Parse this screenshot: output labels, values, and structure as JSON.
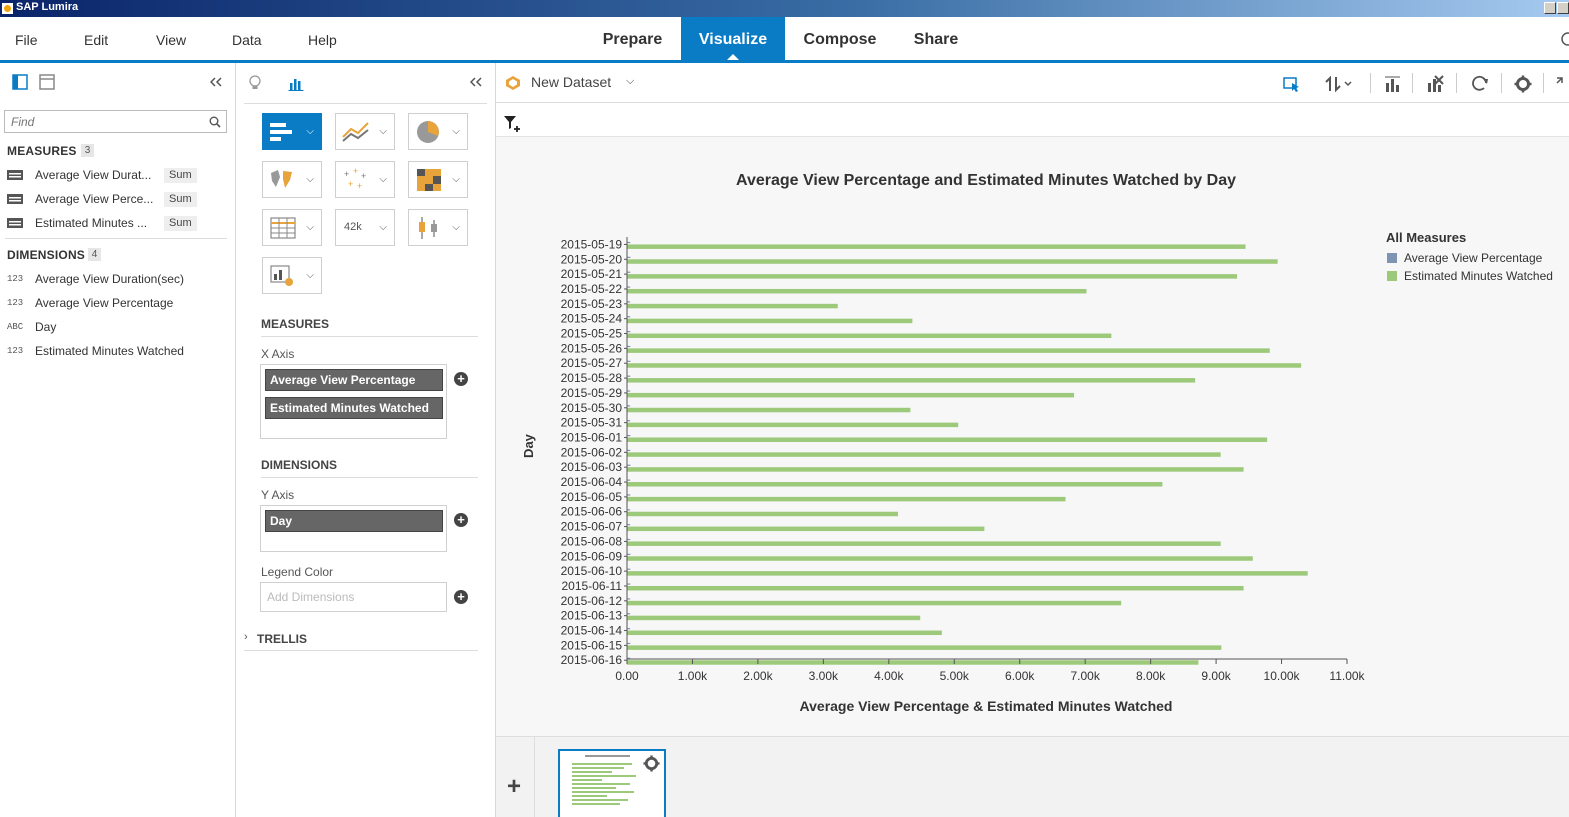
{
  "window": {
    "title": "SAP Lumira"
  },
  "menu": {
    "items": [
      "File",
      "Edit",
      "View",
      "Data",
      "Help"
    ]
  },
  "rooms": {
    "prepare": "Prepare",
    "visualize": "Visualize",
    "compose": "Compose",
    "share": "Share"
  },
  "left_panel": {
    "search_placeholder": "Find",
    "measures_header": "MEASURES",
    "measures_count": "3",
    "measures": [
      {
        "label": "Average View Durat...",
        "agg": "Sum"
      },
      {
        "label": "Average View Perce...",
        "agg": "Sum"
      },
      {
        "label": "Estimated Minutes ...",
        "agg": "Sum"
      }
    ],
    "dimensions_header": "DIMENSIONS",
    "dimensions_count": "4",
    "dimensions": [
      {
        "type": "123",
        "label": "Average View Duration(sec)"
      },
      {
        "type": "123",
        "label": "Average View Percentage"
      },
      {
        "type": "ABC",
        "label": "Day"
      },
      {
        "type": "123",
        "label": "Estimated Minutes Watched"
      }
    ]
  },
  "feed_panel": {
    "counter_glyph": "42k",
    "measures_header": "MEASURES",
    "x_axis_label": "X Axis",
    "x_axis_items": [
      "Average View Percentage",
      "Estimated Minutes Watched"
    ],
    "dimensions_header": "DIMENSIONS",
    "y_axis_label": "Y Axis",
    "y_axis_items": [
      "Day"
    ],
    "legend_color_label": "Legend Color",
    "legend_color_placeholder": "Add Dimensions",
    "trellis_label": "TRELLIS"
  },
  "workspace": {
    "dataset_name": "New Dataset"
  },
  "colors": {
    "accent": "#0a7cc5",
    "series_avg_pct": "#7f93b2",
    "series_est_min": "#9dc97b"
  },
  "chart_data": {
    "type": "bar",
    "orientation": "horizontal",
    "title": "Average View Percentage and Estimated Minutes Watched by Day",
    "xlabel": "Average View Percentage & Estimated Minutes Watched",
    "ylabel": "Day",
    "xlim": [
      0,
      11000
    ],
    "xticks": [
      0,
      1000,
      2000,
      3000,
      4000,
      5000,
      6000,
      7000,
      8000,
      9000,
      10000,
      11000
    ],
    "xtick_labels": [
      "0.00",
      "1.00k",
      "2.00k",
      "3.00k",
      "4.00k",
      "5.00k",
      "6.00k",
      "7.00k",
      "8.00k",
      "9.00k",
      "10.00k",
      "11.00k"
    ],
    "grid": false,
    "legend_title": "All Measures",
    "legend_position": "top-right",
    "categories": [
      "2015-05-19",
      "2015-05-20",
      "2015-05-21",
      "2015-05-22",
      "2015-05-23",
      "2015-05-24",
      "2015-05-25",
      "2015-05-26",
      "2015-05-27",
      "2015-05-28",
      "2015-05-29",
      "2015-05-30",
      "2015-05-31",
      "2015-06-01",
      "2015-06-02",
      "2015-06-03",
      "2015-06-04",
      "2015-06-05",
      "2015-06-06",
      "2015-06-07",
      "2015-06-08",
      "2015-06-09",
      "2015-06-10",
      "2015-06-11",
      "2015-06-12",
      "2015-06-13",
      "2015-06-14",
      "2015-06-15",
      "2015-06-16"
    ],
    "series": [
      {
        "name": "Average View Percentage",
        "values": [
          50,
          52,
          51,
          49,
          47,
          48,
          50,
          51,
          52,
          50,
          49,
          48,
          47,
          51,
          50,
          52,
          49,
          50,
          48,
          47,
          50,
          52,
          51,
          50,
          49,
          48,
          47,
          50,
          49
        ]
      },
      {
        "name": "Estimated Minutes Watched",
        "values": [
          9450,
          9940,
          9320,
          7020,
          3220,
          4360,
          7400,
          9820,
          10300,
          8680,
          6830,
          4330,
          5060,
          9780,
          9070,
          9420,
          8180,
          6700,
          4140,
          5460,
          9070,
          9560,
          10400,
          9420,
          7550,
          4480,
          4810,
          9080,
          8730
        ]
      }
    ]
  }
}
